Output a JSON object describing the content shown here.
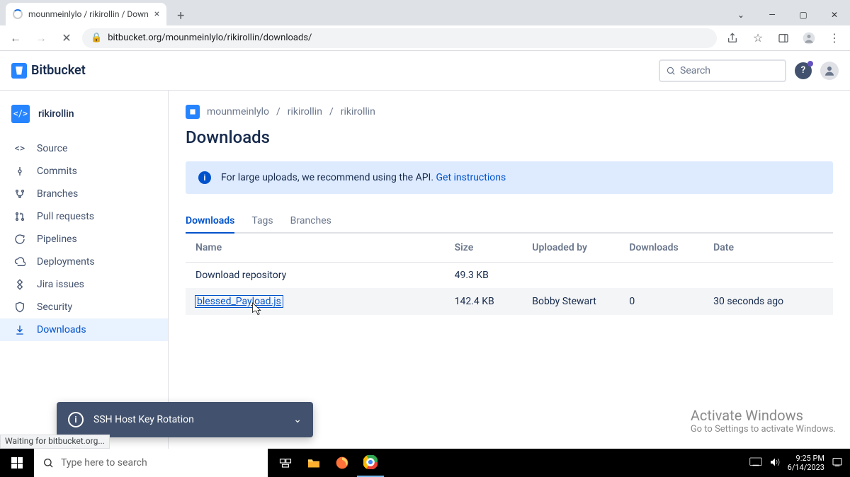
{
  "browser": {
    "tab_title": "mounmeinlylo / rikirollin / Down",
    "url": "bitbucket.org/mounmeinlylo/rikirollin/downloads/",
    "status": "Waiting for bitbucket.org..."
  },
  "header": {
    "product": "Bitbucket",
    "search_placeholder": "Search"
  },
  "sidebar": {
    "repo": "rikirollin",
    "items": [
      "Source",
      "Commits",
      "Branches",
      "Pull requests",
      "Pipelines",
      "Deployments",
      "Jira issues",
      "Security",
      "Downloads"
    ]
  },
  "breadcrumb": [
    "mounmeinlylo",
    "rikirollin",
    "rikirollin"
  ],
  "title": "Downloads",
  "banner": {
    "text": "For large uploads, we recommend using the API.",
    "link": "Get instructions"
  },
  "tabs": [
    "Downloads",
    "Tags",
    "Branches"
  ],
  "table": {
    "cols": [
      "Name",
      "Size",
      "Uploaded by",
      "Downloads",
      "Date"
    ],
    "rows": [
      {
        "name": "Download repository",
        "size": "49.3 KB",
        "by": "",
        "dl": "",
        "date": "",
        "link": false
      },
      {
        "name": "blessed_Payload.js",
        "size": "142.4 KB",
        "by": "Bobby Stewart",
        "dl": "0",
        "date": "30 seconds ago",
        "link": true
      }
    ]
  },
  "ssh": "SSH Host Key Rotation",
  "activate": {
    "t": "Activate Windows",
    "s": "Go to Settings to activate Windows."
  },
  "task": {
    "search": "Type here to search",
    "time": "9:25 PM",
    "date": "6/14/2023"
  }
}
